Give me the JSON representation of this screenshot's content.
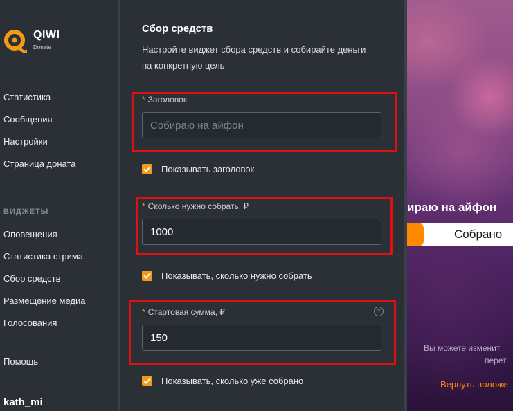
{
  "app": {
    "logo_text": "QIWI",
    "logo_sub": "Donate",
    "brand_color": "#f39b16",
    "logo_icon": "qiwi-logo-icon"
  },
  "sidebar": {
    "items": [
      {
        "label": "Статистика"
      },
      {
        "label": "Сообщения"
      },
      {
        "label": "Настройки"
      },
      {
        "label": "Страница доната"
      }
    ],
    "section_label": "ВИДЖЕТЫ",
    "widget_items": [
      {
        "label": "Оповещения"
      },
      {
        "label": "Статистика стрима"
      },
      {
        "label": "Сбор средств"
      },
      {
        "label": "Размещение медиа"
      },
      {
        "label": "Голосования"
      }
    ],
    "help": "Помощь",
    "username": "kath_mi"
  },
  "form": {
    "title": "Сбор средств",
    "description": "Настройте виджет сбора средств и собирайте деньги на конкретную цель",
    "fields": [
      {
        "label": "Заголовок",
        "required_mark": "*",
        "value": "",
        "placeholder": "Собираю на айфон"
      },
      {
        "label": "Сколько нужно собрать, ₽",
        "required_mark": "*",
        "value": "1000",
        "placeholder": ""
      },
      {
        "label": "Стартовая сумма, ₽",
        "required_mark": "*",
        "value": "150",
        "placeholder": "",
        "help_icon": "?"
      }
    ],
    "checkboxes": [
      {
        "label": "Показывать заголовок",
        "checked": true
      },
      {
        "label": "Показывать, сколько нужно собрать",
        "checked": true
      },
      {
        "label": "Показывать, сколько уже собрано",
        "checked": true
      }
    ]
  },
  "preview": {
    "title": "ираю на айфон",
    "progress_text": "Собрано",
    "progress_fraction": 0.15,
    "hint_line1": "Вы можете изменит",
    "hint_line2": "перет",
    "reset_link": "Вернуть положе"
  }
}
